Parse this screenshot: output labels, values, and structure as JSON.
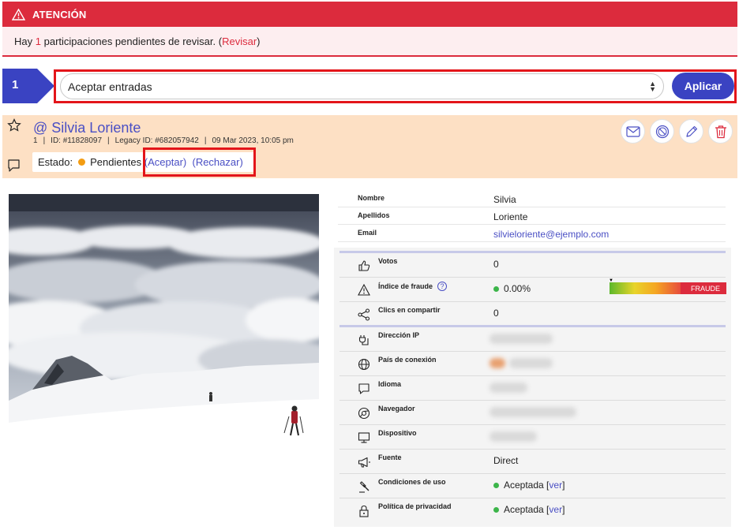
{
  "alert": {
    "title": "ATENCIÓN",
    "msg_prefix": "Hay",
    "count": "1",
    "msg_suffix": "participaciones pendientes de revisar. (",
    "link": "Revisar",
    "msg_end": ")"
  },
  "bulk": {
    "step": "1",
    "selected": "Aceptar entradas",
    "apply": "Aplicar"
  },
  "entry": {
    "at": "@",
    "name": "Silvia Loriente",
    "index": "1",
    "id": "ID: #11828097",
    "legacy": "Legacy ID: #682057942",
    "date": "09 Mar 2023, 10:05 pm",
    "estado_label": "Estado:",
    "estado_value": "Pendientes",
    "accept": "(Aceptar)",
    "reject": "(Rechazar)",
    "status_color": "#f39c12"
  },
  "actions": [
    "mail-icon",
    "block-icon",
    "edit-icon",
    "delete-icon"
  ],
  "details": [
    {
      "label": "Nombre",
      "value": "Silvia"
    },
    {
      "label": "Apellidos",
      "value": "Loriente"
    },
    {
      "label": "Email",
      "value": "silvieloriente@ejemplo.com"
    }
  ],
  "stats": {
    "votos": {
      "label": "Votos",
      "value": "0"
    },
    "fraude": {
      "label": "Índice de fraude",
      "help": "?",
      "value": "0.00%",
      "bar_label": "FRAUDE"
    },
    "clics": {
      "label": "Clics en compartir",
      "value": "0"
    }
  },
  "tech": {
    "ip": "Dirección IP",
    "pais": "País de conexión",
    "idioma": "Idioma",
    "navegador": "Navegador",
    "dispositivo": "Dispositivo",
    "fuente": {
      "label": "Fuente",
      "value": "Direct"
    },
    "condiciones": {
      "label": "Condiciones de uso",
      "value": "Aceptada",
      "link": "ver"
    },
    "privacidad": {
      "label": "Política de privacidad",
      "value": "Aceptada",
      "link": "ver"
    }
  },
  "colors": {
    "accent": "#3a43c2",
    "alert": "#dc2b3d",
    "header_bg": "#fde0c4",
    "ok": "#3cb54a"
  }
}
